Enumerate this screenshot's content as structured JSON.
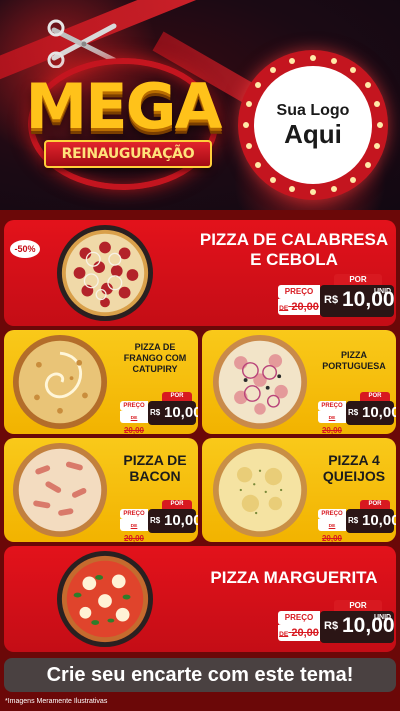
{
  "header": {
    "title_big": "MEGA",
    "title_banner": "REINAUGURAÇÃO",
    "logo_line1": "Sua Logo",
    "logo_line2": "Aqui"
  },
  "colors": {
    "red": "#e3121b",
    "yellow": "#f9c91a",
    "dark": "#2b1515",
    "bg": "#6b0808"
  },
  "products": [
    {
      "name_l1": "PIZZA DE CALABRESA",
      "name_l2": "E CEBOLA",
      "badge": "-50%",
      "por": "POR",
      "preco": "PREÇO",
      "de": "DE",
      "old": "20,00",
      "cur": "R$",
      "value": "10,00",
      "unid": "UNID"
    },
    {
      "name_l1": "PIZZA DE",
      "name_l2": "FRANGO COM",
      "name_l3": "CATUPIRY",
      "por": "POR",
      "preco": "PREÇO",
      "de": "DE",
      "old": "20,00",
      "cur": "R$",
      "value": "10,00"
    },
    {
      "name_l1": "PIZZA",
      "name_l2": "PORTUGUESA",
      "por": "POR",
      "preco": "PREÇO",
      "de": "DE",
      "old": "20,00",
      "cur": "R$",
      "value": "10,00"
    },
    {
      "name_l1": "PIZZA DE",
      "name_l2": "BACON",
      "por": "POR",
      "preco": "PREÇO",
      "de": "DE",
      "old": "20,00",
      "cur": "R$",
      "value": "10,00"
    },
    {
      "name_l1": "PIZZA 4",
      "name_l2": "QUEIJOS",
      "por": "POR",
      "preco": "PREÇO",
      "de": "DE",
      "old": "20,00",
      "cur": "R$",
      "value": "10,00"
    },
    {
      "name_l1": "PIZZA MARGUERITA",
      "por": "POR",
      "preco": "PREÇO",
      "de": "DE",
      "old": "20,00",
      "cur": "R$",
      "value": "10,00",
      "unid": "UNID"
    }
  ],
  "cta": "Crie seu encarte com este tema!",
  "disclaimer": "*Imagens Meramente Ilustrativas"
}
